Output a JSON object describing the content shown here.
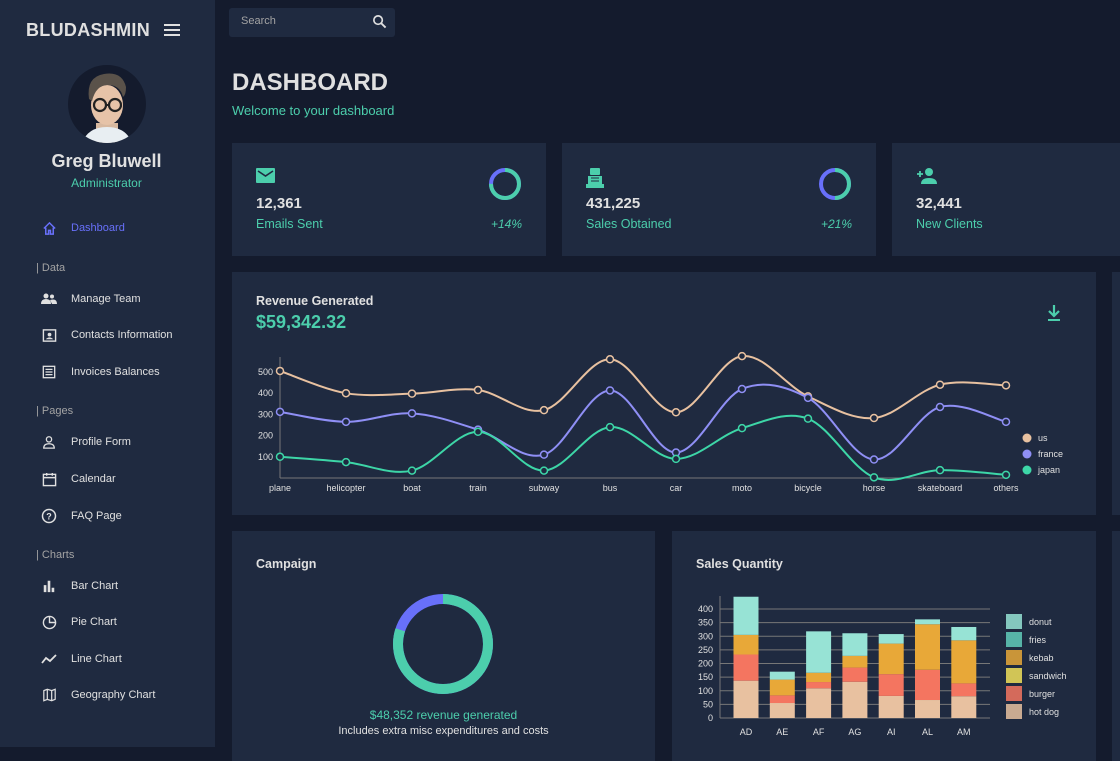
{
  "app": {
    "title": "BLUDASHMIN"
  },
  "user": {
    "name": "Greg Bluwell",
    "role": "Administrator"
  },
  "nav": {
    "dashboard": "Dashboard",
    "sections": [
      "Data",
      "Pages",
      "Charts"
    ],
    "data_items": [
      "Manage Team",
      "Contacts Information",
      "Invoices Balances"
    ],
    "page_items": [
      "Profile Form",
      "Calendar",
      "FAQ Page"
    ],
    "chart_items": [
      "Bar Chart",
      "Pie Chart",
      "Line Chart",
      "Geography Chart"
    ]
  },
  "search": {
    "placeholder": "Search"
  },
  "header": {
    "title": "DASHBOARD",
    "subtitle": "Welcome to your dashboard"
  },
  "stats": [
    {
      "icon": "email-icon",
      "value": "12,361",
      "label": "Emails Sent",
      "change": "+14%",
      "progress": 0.75
    },
    {
      "icon": "point-of-sale-icon",
      "value": "431,225",
      "label": "Sales Obtained",
      "change": "+21%",
      "progress": 0.5
    },
    {
      "icon": "person-add-icon",
      "value": "32,441",
      "label": "New Clients"
    }
  ],
  "revenue": {
    "title": "Revenue Generated",
    "amount": "$59,342.32"
  },
  "campaign": {
    "title": "Campaign",
    "revenue": "$48,352 revenue generated",
    "note": "Includes extra misc expenditures and costs",
    "progress": 0.8
  },
  "sales": {
    "title": "Sales Quantity"
  },
  "colors": {
    "bg": "#141b2d",
    "panel": "#1f2a40",
    "accent": "#4cceac",
    "blue": "#6870fa"
  },
  "chart_data": [
    {
      "type": "line",
      "categories": [
        "plane",
        "helicopter",
        "boat",
        "train",
        "subway",
        "bus",
        "car",
        "moto",
        "bicycle",
        "horse",
        "skateboard",
        "others"
      ],
      "yticks": [
        100,
        200,
        300,
        400,
        500
      ],
      "ylim": [
        0,
        580
      ],
      "legend": "right",
      "series": [
        {
          "name": "us",
          "color": "#e8c1a0",
          "values": [
            505,
            400,
            398,
            415,
            320,
            560,
            310,
            575,
            385,
            283,
            440,
            437
          ]
        },
        {
          "name": "france",
          "color": "#8f8ff5",
          "values": [
            312,
            265,
            305,
            228,
            110,
            413,
            120,
            420,
            378,
            87,
            335,
            265
          ]
        },
        {
          "name": "japan",
          "color": "#3dd6a7",
          "values": [
            100,
            75,
            35,
            218,
            35,
            240,
            90,
            235,
            280,
            3,
            37,
            15
          ]
        }
      ]
    },
    {
      "type": "bar",
      "stacked": true,
      "categories": [
        "AD",
        "AE",
        "AF",
        "AG",
        "AI",
        "AL",
        "AM"
      ],
      "yticks": [
        0,
        50,
        100,
        150,
        200,
        250,
        300,
        350,
        400
      ],
      "ylim": [
        0,
        400
      ],
      "legend": "right",
      "grid": true,
      "series": [
        {
          "name": "hot dog",
          "color": "#e8c1a0",
          "values": [
            137,
            55,
            109,
            133,
            81,
            66,
            80
          ]
        },
        {
          "name": "burger",
          "color": "#f47560",
          "values": [
            96,
            28,
            23,
            52,
            80,
            111,
            47
          ]
        },
        {
          "name": "sandwich",
          "color": "#f1e15b",
          "values": [
            0,
            0,
            0,
            0,
            0,
            0,
            0
          ]
        },
        {
          "name": "kebab",
          "color": "#e8a838",
          "values": [
            72,
            58,
            34,
            43,
            112,
            167,
            158
          ]
        },
        {
          "name": "fries",
          "color": "#61cdbb",
          "values": [
            0,
            0,
            0,
            0,
            0,
            0,
            0
          ]
        },
        {
          "name": "donut",
          "color": "#97e3d5",
          "values": [
            140,
            29,
            152,
            83,
            35,
            18,
            49
          ]
        }
      ],
      "legend_order": [
        "donut",
        "fries",
        "kebab",
        "sandwich",
        "burger",
        "hot dog"
      ]
    }
  ]
}
